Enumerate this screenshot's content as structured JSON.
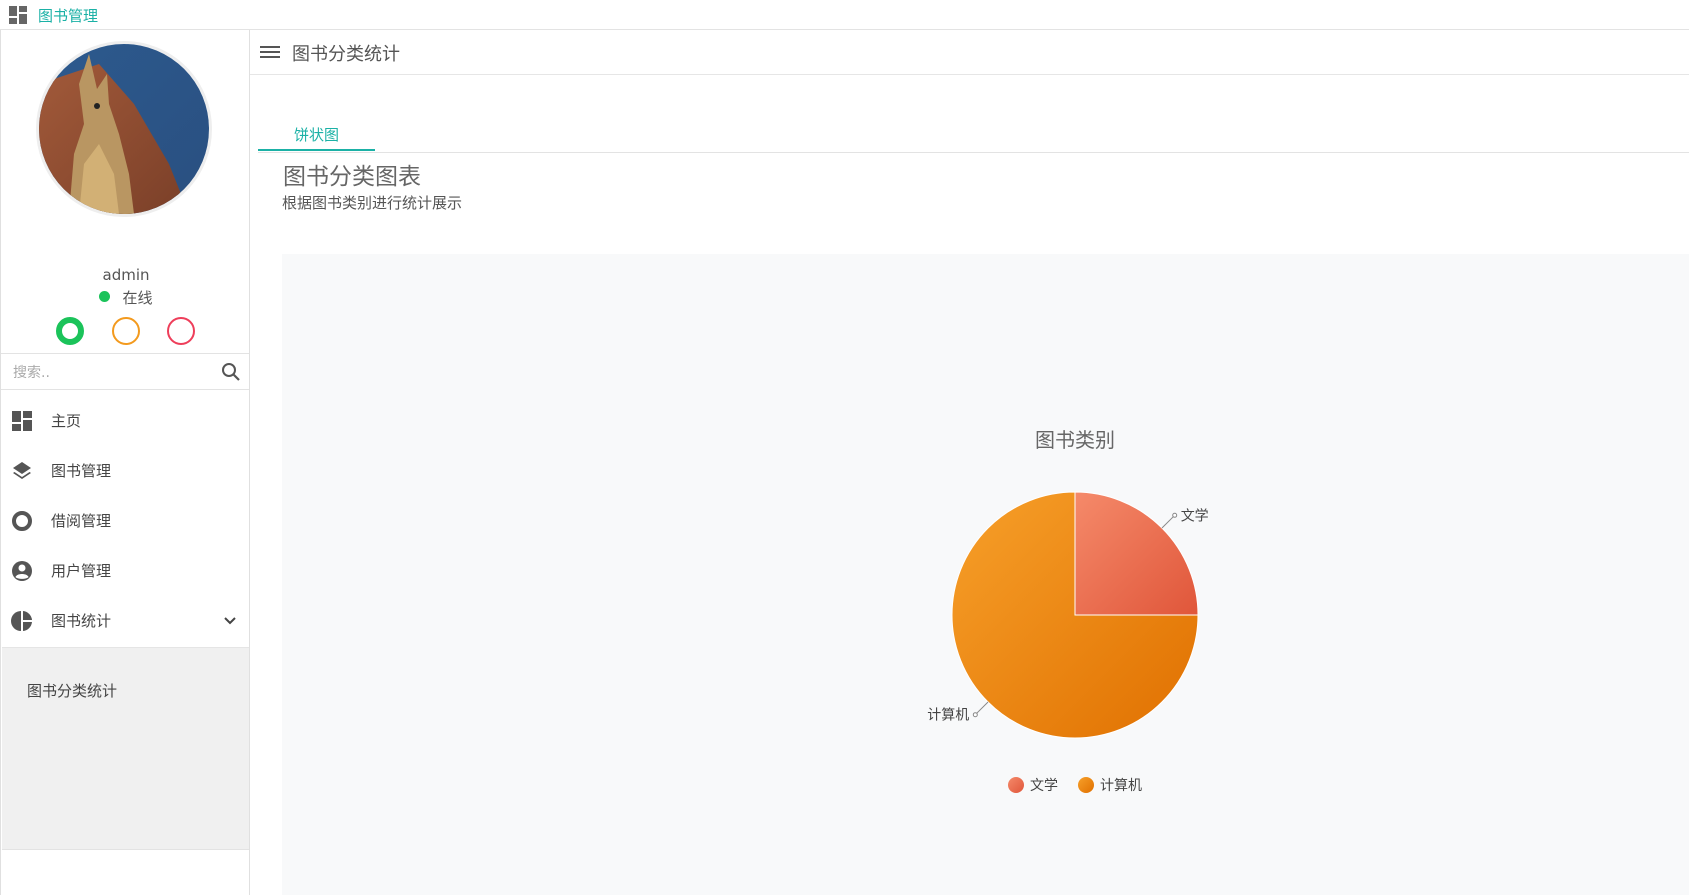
{
  "app": {
    "brand": "图书管理"
  },
  "user": {
    "name": "admin",
    "status": "在线"
  },
  "search": {
    "placeholder": "搜索.."
  },
  "menu": {
    "items": [
      {
        "label": "主页",
        "icon": "dashboard-icon"
      },
      {
        "label": "图书管理",
        "icon": "layers-icon"
      },
      {
        "label": "借阅管理",
        "icon": "circle-icon"
      },
      {
        "label": "用户管理",
        "icon": "user-icon"
      },
      {
        "label": "图书统计",
        "icon": "pie-icon"
      }
    ],
    "submenu": [
      {
        "label": "图书分类统计"
      }
    ]
  },
  "header": {
    "title": "图书分类统计"
  },
  "tabs": [
    {
      "label": "饼状图",
      "active": true
    }
  ],
  "card": {
    "title": "图书分类图表",
    "subtitle": "根据图书类别进行统计展示"
  },
  "colors": {
    "accent": "#1bb1a6",
    "online": "#1bc35a",
    "warn": "#f39a1e",
    "danger": "#ee3e5a"
  },
  "chart_data": {
    "type": "pie",
    "title": "图书类别",
    "categories": [
      "文学",
      "计算机"
    ],
    "values": [
      25,
      75
    ],
    "colors": [
      "#ea6b4b",
      "#f08a10"
    ],
    "legend": "bottom"
  }
}
